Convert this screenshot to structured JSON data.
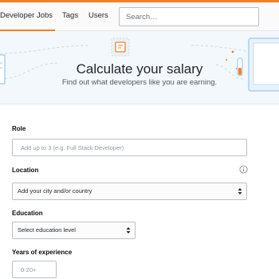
{
  "nav": {
    "tabs": [
      {
        "label": "Developer Jobs",
        "active": true
      },
      {
        "label": "Tags",
        "active": false
      },
      {
        "label": "Users",
        "active": false
      }
    ],
    "search_placeholder": "Search…"
  },
  "hero": {
    "title": "Calculate your salary",
    "subtitle": "Find out what developers like you are earning."
  },
  "form": {
    "role": {
      "label": "Role",
      "placeholder": "Add up to 3 (e.g. Full Stack Developer)"
    },
    "location": {
      "label": "Location",
      "value": "Add your city and/or country",
      "icon": "info-icon"
    },
    "education": {
      "label": "Education",
      "value": "Select education level"
    },
    "experience": {
      "label": "Years of experience",
      "placeholder": "0-20+"
    }
  },
  "colors": {
    "accent": "#f48024",
    "hero_background": "#f3f8fc",
    "illustration_blue": "#9fc9e6"
  }
}
